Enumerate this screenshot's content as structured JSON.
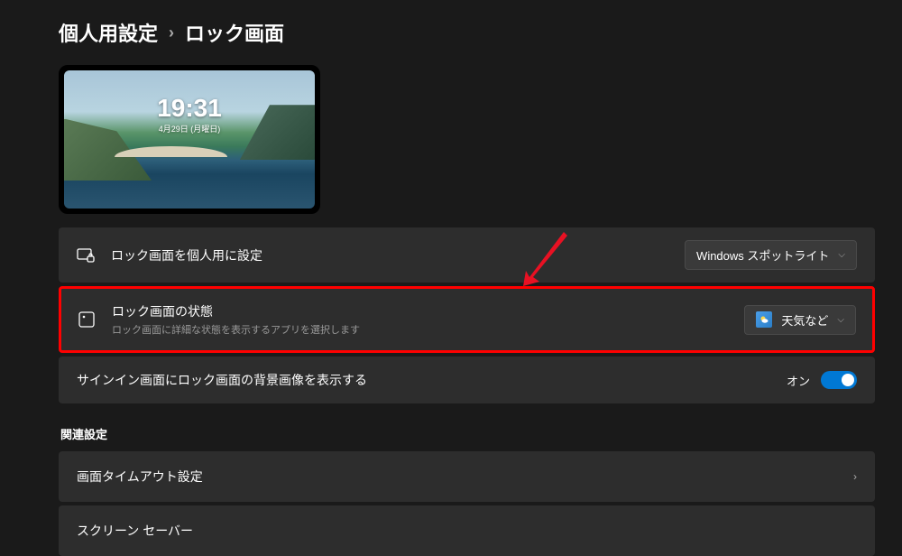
{
  "breadcrumb": {
    "parent": "個人用設定",
    "separator": "›",
    "current": "ロック画面"
  },
  "preview": {
    "time": "19:31",
    "date": "4月29日 (月曜日)"
  },
  "settings": {
    "personalize": {
      "title": "ロック画面を個人用に設定",
      "dropdown_value": "Windows スポットライト"
    },
    "status": {
      "title": "ロック画面の状態",
      "description": "ロック画面に詳細な状態を表示するアプリを選択します",
      "dropdown_value": "天気など"
    },
    "signin_bg": {
      "label": "サインイン画面にロック画面の背景画像を表示する",
      "state": "オン"
    }
  },
  "related": {
    "header": "関連設定",
    "timeout": "画面タイムアウト設定",
    "screensaver": "スクリーン セーバー"
  }
}
